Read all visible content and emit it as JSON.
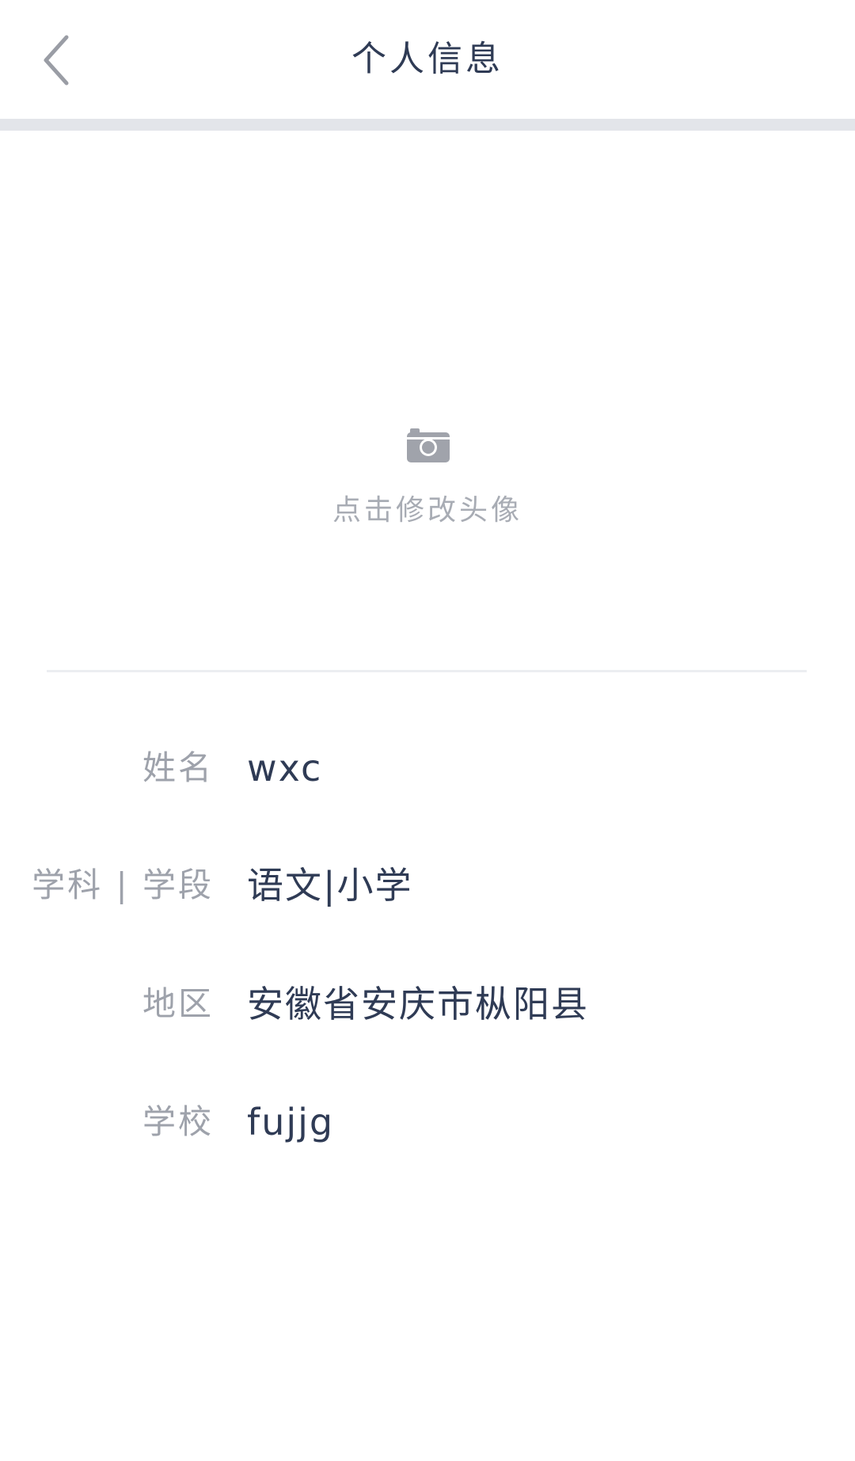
{
  "header": {
    "title": "个人信息",
    "back_icon": "chevron-left-icon"
  },
  "avatar": {
    "icon": "camera-icon",
    "hint": "点击修改头像"
  },
  "info": {
    "rows": [
      {
        "label": "姓名",
        "value": "wxc"
      },
      {
        "label": "学科 | 学段",
        "value": "语文|小学"
      },
      {
        "label": "地区",
        "value": "安徽省安庆市枞阳县"
      },
      {
        "label": "学校",
        "value": "fujjg"
      }
    ]
  },
  "colors": {
    "title_text": "#2f3b55",
    "label_text": "#9ea2ab",
    "value_text": "#2f3b55",
    "icon_gray": "#a0a3ab",
    "divider": "#e3e5ea"
  }
}
